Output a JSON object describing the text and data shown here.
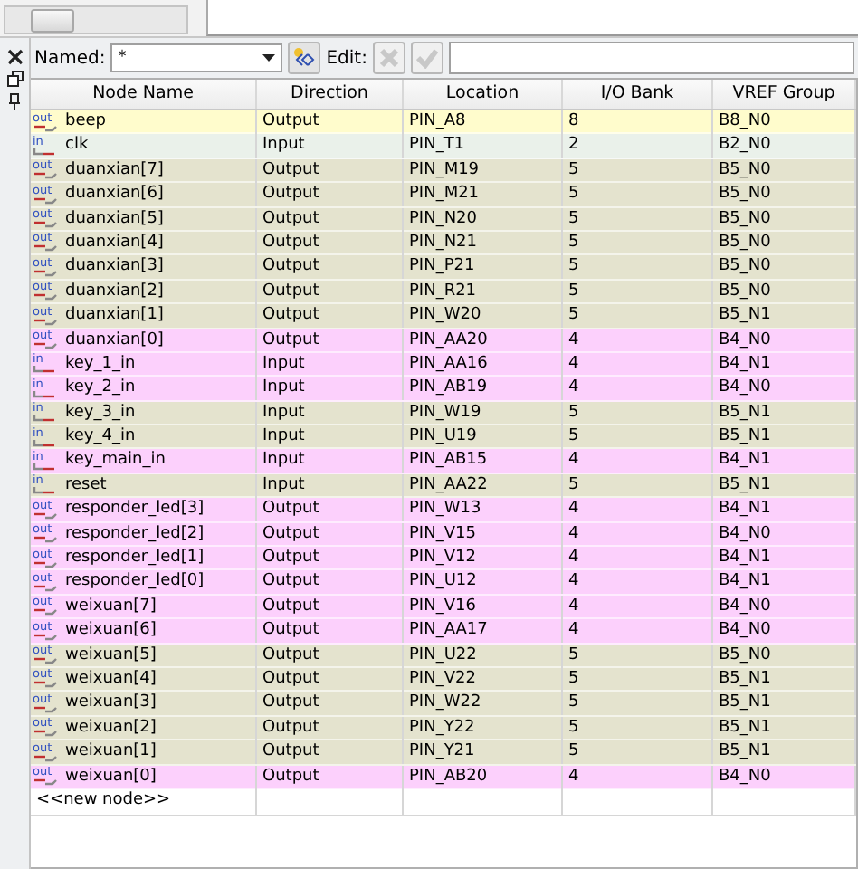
{
  "toolbar": {
    "named_label": "Named:",
    "named_value": "*",
    "edit_label": "Edit:",
    "edit_buttons": [
      {
        "kind": "cancel",
        "disabled": true
      },
      {
        "kind": "accept",
        "disabled": true
      }
    ]
  },
  "table": {
    "columns": [
      "Node Name",
      "Direction",
      "Location",
      "I/O Bank",
      "VREF Group"
    ],
    "rows": [
      {
        "icon": "out",
        "name": "beep",
        "direction": "Output",
        "location": "PIN_A8",
        "bank": "8",
        "vref": "B8_N0",
        "color": "#fffccc"
      },
      {
        "icon": "in",
        "name": "clk",
        "direction": "Input",
        "location": "PIN_T1",
        "bank": "2",
        "vref": "B2_N0",
        "color": "#eaf1ea"
      },
      {
        "icon": "out",
        "name": "duanxian[7]",
        "direction": "Output",
        "location": "PIN_M19",
        "bank": "5",
        "vref": "B5_N0",
        "color": "#e4e3ce"
      },
      {
        "icon": "out",
        "name": "duanxian[6]",
        "direction": "Output",
        "location": "PIN_M21",
        "bank": "5",
        "vref": "B5_N0",
        "color": "#e4e3ce"
      },
      {
        "icon": "out",
        "name": "duanxian[5]",
        "direction": "Output",
        "location": "PIN_N20",
        "bank": "5",
        "vref": "B5_N0",
        "color": "#e4e3ce"
      },
      {
        "icon": "out",
        "name": "duanxian[4]",
        "direction": "Output",
        "location": "PIN_N21",
        "bank": "5",
        "vref": "B5_N0",
        "color": "#e4e3ce"
      },
      {
        "icon": "out",
        "name": "duanxian[3]",
        "direction": "Output",
        "location": "PIN_P21",
        "bank": "5",
        "vref": "B5_N0",
        "color": "#e4e3ce"
      },
      {
        "icon": "out",
        "name": "duanxian[2]",
        "direction": "Output",
        "location": "PIN_R21",
        "bank": "5",
        "vref": "B5_N0",
        "color": "#e4e3ce"
      },
      {
        "icon": "out",
        "name": "duanxian[1]",
        "direction": "Output",
        "location": "PIN_W20",
        "bank": "5",
        "vref": "B5_N1",
        "color": "#e4e3ce"
      },
      {
        "icon": "out",
        "name": "duanxian[0]",
        "direction": "Output",
        "location": "PIN_AA20",
        "bank": "4",
        "vref": "B4_N0",
        "color": "#fcd0fc"
      },
      {
        "icon": "in",
        "name": "key_1_in",
        "direction": "Input",
        "location": "PIN_AA16",
        "bank": "4",
        "vref": "B4_N1",
        "color": "#fcd0fc"
      },
      {
        "icon": "in",
        "name": "key_2_in",
        "direction": "Input",
        "location": "PIN_AB19",
        "bank": "4",
        "vref": "B4_N0",
        "color": "#fcd0fc"
      },
      {
        "icon": "in",
        "name": "key_3_in",
        "direction": "Input",
        "location": "PIN_W19",
        "bank": "5",
        "vref": "B5_N1",
        "color": "#e4e3ce"
      },
      {
        "icon": "in",
        "name": "key_4_in",
        "direction": "Input",
        "location": "PIN_U19",
        "bank": "5",
        "vref": "B5_N1",
        "color": "#e4e3ce"
      },
      {
        "icon": "in",
        "name": "key_main_in",
        "direction": "Input",
        "location": "PIN_AB15",
        "bank": "4",
        "vref": "B4_N1",
        "color": "#fcd0fc"
      },
      {
        "icon": "in",
        "name": "reset",
        "direction": "Input",
        "location": "PIN_AA22",
        "bank": "5",
        "vref": "B5_N1",
        "color": "#e4e3ce"
      },
      {
        "icon": "out",
        "name": "responder_led[3]",
        "direction": "Output",
        "location": "PIN_W13",
        "bank": "4",
        "vref": "B4_N1",
        "color": "#fcd0fc"
      },
      {
        "icon": "out",
        "name": "responder_led[2]",
        "direction": "Output",
        "location": "PIN_V15",
        "bank": "4",
        "vref": "B4_N0",
        "color": "#fcd0fc"
      },
      {
        "icon": "out",
        "name": "responder_led[1]",
        "direction": "Output",
        "location": "PIN_V12",
        "bank": "4",
        "vref": "B4_N1",
        "color": "#fcd0fc"
      },
      {
        "icon": "out",
        "name": "responder_led[0]",
        "direction": "Output",
        "location": "PIN_U12",
        "bank": "4",
        "vref": "B4_N1",
        "color": "#fcd0fc"
      },
      {
        "icon": "out",
        "name": "weixuan[7]",
        "direction": "Output",
        "location": "PIN_V16",
        "bank": "4",
        "vref": "B4_N0",
        "color": "#fcd0fc"
      },
      {
        "icon": "out",
        "name": "weixuan[6]",
        "direction": "Output",
        "location": "PIN_AA17",
        "bank": "4",
        "vref": "B4_N0",
        "color": "#fcd0fc"
      },
      {
        "icon": "out",
        "name": "weixuan[5]",
        "direction": "Output",
        "location": "PIN_U22",
        "bank": "5",
        "vref": "B5_N0",
        "color": "#e4e3ce"
      },
      {
        "icon": "out",
        "name": "weixuan[4]",
        "direction": "Output",
        "location": "PIN_V22",
        "bank": "5",
        "vref": "B5_N1",
        "color": "#e4e3ce"
      },
      {
        "icon": "out",
        "name": "weixuan[3]",
        "direction": "Output",
        "location": "PIN_W22",
        "bank": "5",
        "vref": "B5_N1",
        "color": "#e4e3ce"
      },
      {
        "icon": "out",
        "name": "weixuan[2]",
        "direction": "Output",
        "location": "PIN_Y22",
        "bank": "5",
        "vref": "B5_N1",
        "color": "#e4e3ce"
      },
      {
        "icon": "out",
        "name": "weixuan[1]",
        "direction": "Output",
        "location": "PIN_Y21",
        "bank": "5",
        "vref": "B5_N1",
        "color": "#e4e3ce"
      },
      {
        "icon": "out",
        "name": "weixuan[0]",
        "direction": "Output",
        "location": "PIN_AB20",
        "bank": "4",
        "vref": "B4_N0",
        "color": "#fcd0fc"
      }
    ],
    "new_row": "<<new node>>"
  }
}
